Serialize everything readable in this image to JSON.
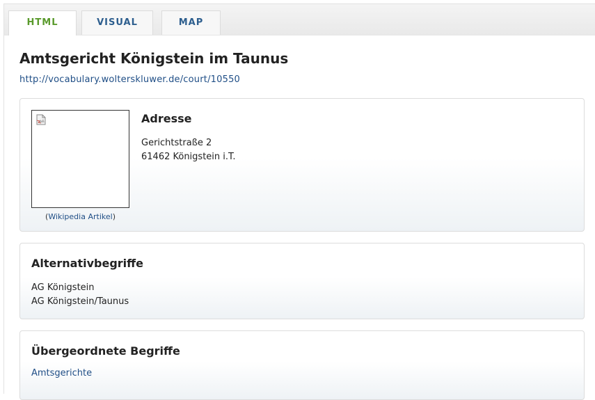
{
  "tabs": [
    {
      "label": "HTML",
      "active": true
    },
    {
      "label": "VISUAL",
      "active": false
    },
    {
      "label": "MAP",
      "active": false
    }
  ],
  "page": {
    "title": "Amtsgericht Königstein im Taunus",
    "uri": "http://vocabulary.wolterskluwer.de/court/10550"
  },
  "address": {
    "heading": "Adresse",
    "street": "Gerichtstraße 2",
    "city": "61462 Königstein i.T.",
    "image_icon": "broken-image-icon",
    "caption_open": "(",
    "caption_link": "Wikipedia Artikel",
    "caption_close": ")"
  },
  "alternatives": {
    "heading": "Alternativbegriffe",
    "items": [
      "AG Königstein",
      "AG Königstein/Taunus"
    ]
  },
  "broader": {
    "heading": "Übergeordnete Begriffe",
    "items": [
      "Amtsgerichte"
    ]
  },
  "colors": {
    "active_tab": "#5a9a2c",
    "tab_text": "#2d5e8e",
    "link": "#1f4e86",
    "panel_border": "#dcdcdc"
  }
}
